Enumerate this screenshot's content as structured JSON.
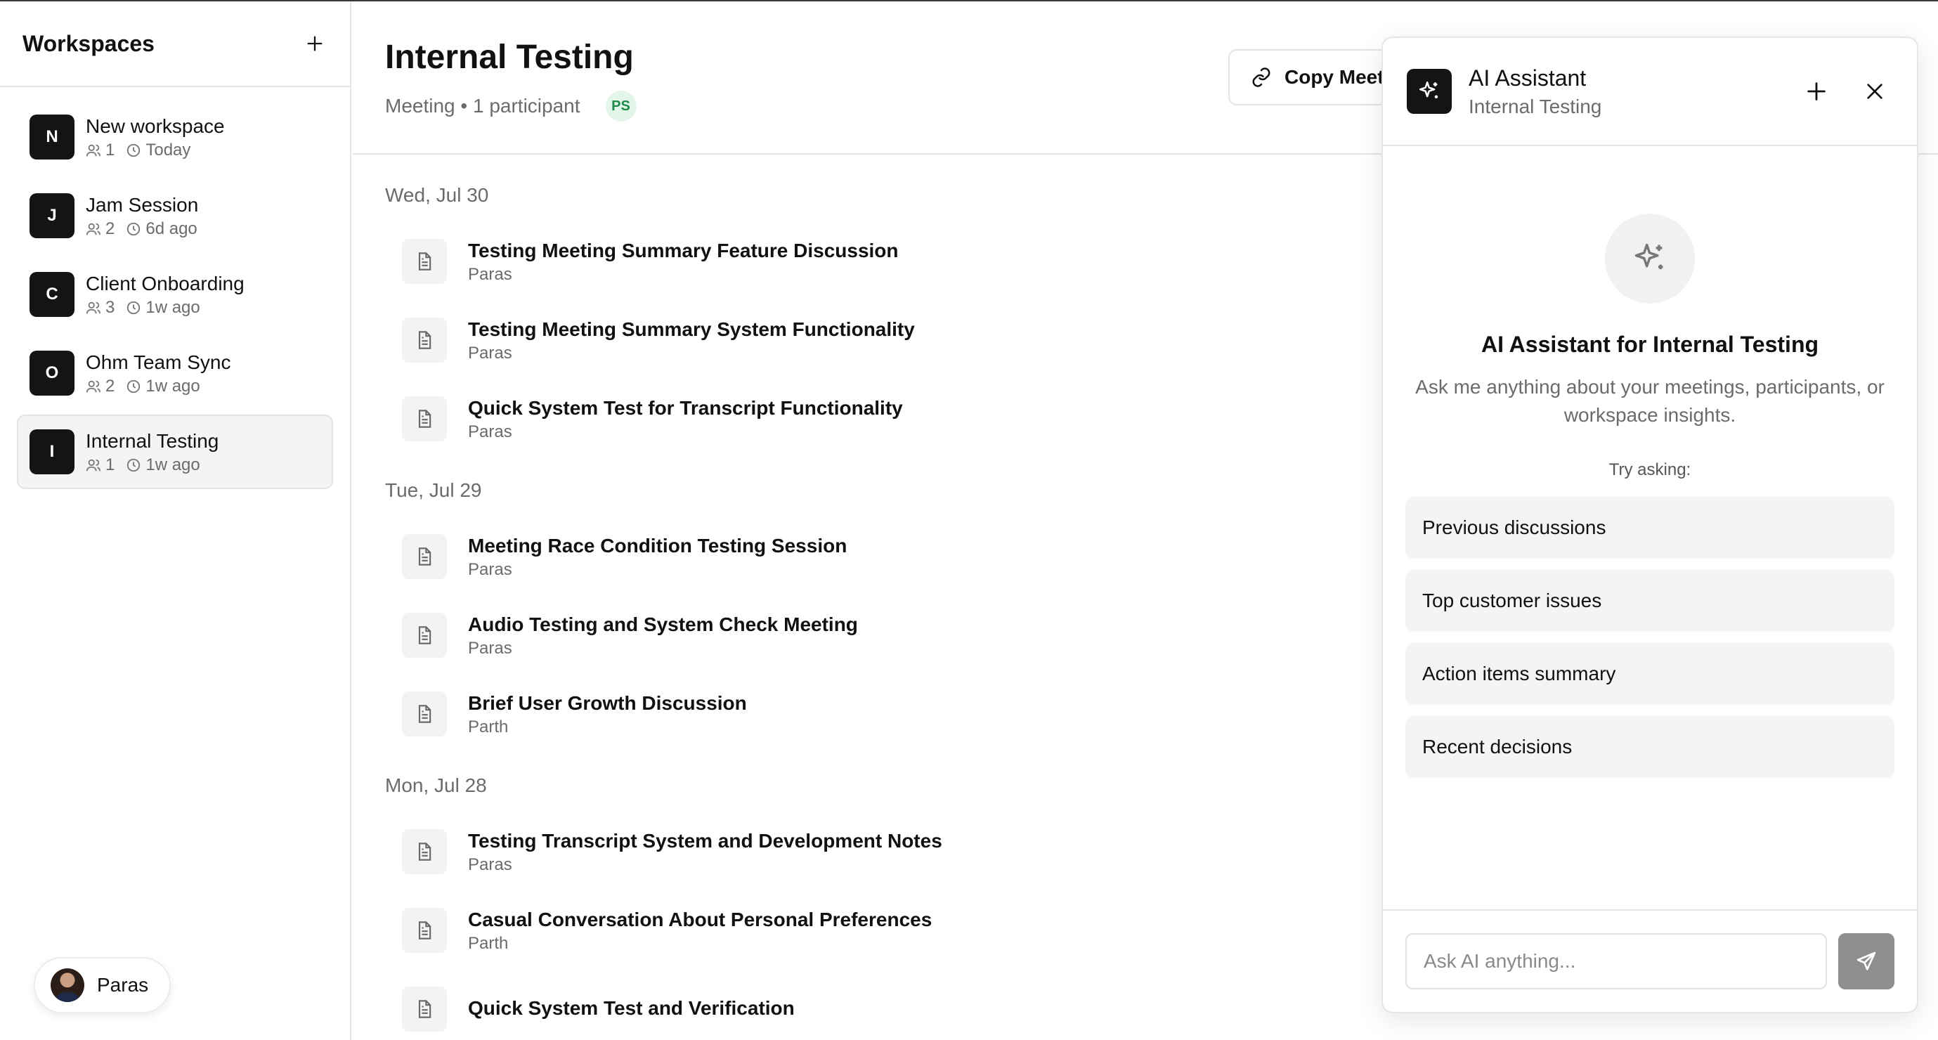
{
  "sidebar": {
    "title": "Workspaces",
    "workspaces": [
      {
        "initial": "N",
        "name": "New workspace",
        "members": "1",
        "time": "Today"
      },
      {
        "initial": "J",
        "name": "Jam Session",
        "members": "2",
        "time": "6d ago"
      },
      {
        "initial": "C",
        "name": "Client Onboarding",
        "members": "3",
        "time": "1w ago"
      },
      {
        "initial": "O",
        "name": "Ohm Team Sync",
        "members": "2",
        "time": "1w ago"
      },
      {
        "initial": "I",
        "name": "Internal Testing",
        "members": "1",
        "time": "1w ago",
        "active": true
      }
    ],
    "user": {
      "name": "Paras"
    }
  },
  "main": {
    "title": "Internal Testing",
    "subtitle": "Meeting • 1 participant",
    "participant_badge": "PS",
    "copy_button": "Copy Meeting Link",
    "days": [
      {
        "label": "Wed, Jul 30",
        "meetings": [
          {
            "title": "Testing Meeting Summary Feature Discussion",
            "author": "Paras"
          },
          {
            "title": "Testing Meeting Summary System Functionality",
            "author": "Paras"
          },
          {
            "title": "Quick System Test for Transcript Functionality",
            "author": "Paras"
          }
        ]
      },
      {
        "label": "Tue, Jul 29",
        "meetings": [
          {
            "title": "Meeting Race Condition Testing Session",
            "author": "Paras"
          },
          {
            "title": "Audio Testing and System Check Meeting",
            "author": "Paras"
          },
          {
            "title": "Brief User Growth Discussion",
            "author": "Parth"
          }
        ]
      },
      {
        "label": "Mon, Jul 28",
        "meetings": [
          {
            "title": "Testing Transcript System and Development Notes",
            "author": "Paras"
          },
          {
            "title": "Casual Conversation About Personal Preferences",
            "author": "Parth"
          },
          {
            "title": "Quick System Test and Verification",
            "author": ""
          }
        ]
      }
    ]
  },
  "ai": {
    "title": "AI Assistant",
    "subtitle": "Internal Testing",
    "hero_title": "AI Assistant for Internal Testing",
    "hero_desc": "Ask me anything about your meetings, participants, or workspace insights.",
    "try_label": "Try asking:",
    "suggestions": [
      "Previous discussions",
      "Top customer issues",
      "Action items summary",
      "Recent decisions"
    ],
    "input_placeholder": "Ask AI anything..."
  }
}
